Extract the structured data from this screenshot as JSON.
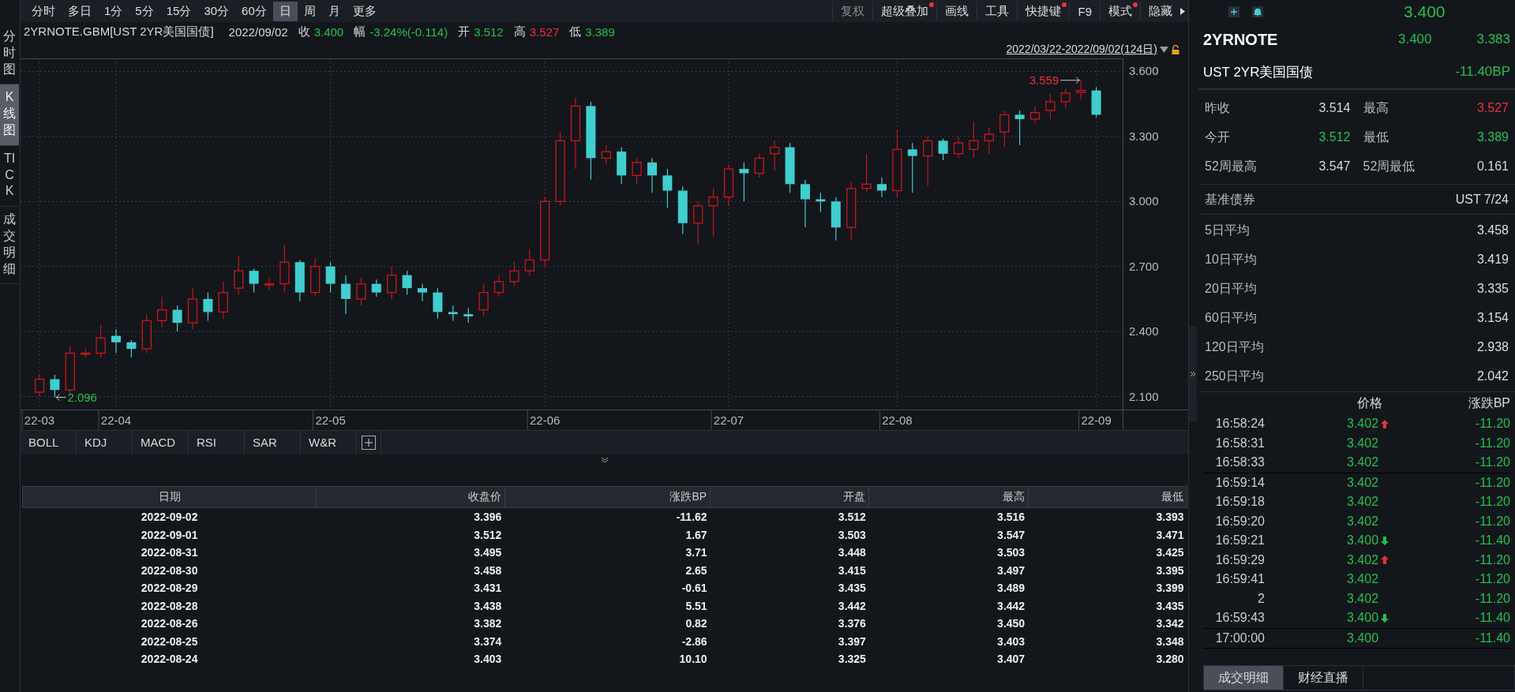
{
  "side_tabs": [
    {
      "label": "分时图",
      "selected": false
    },
    {
      "label": "K线图",
      "selected": true
    },
    {
      "label": "TICK",
      "selected": false
    },
    {
      "label": "成交明细",
      "selected": false
    }
  ],
  "toolbar": {
    "periods": [
      {
        "label": "分时",
        "selected": false
      },
      {
        "label": "多日",
        "selected": false
      },
      {
        "label": "1分",
        "selected": false
      },
      {
        "label": "5分",
        "selected": false
      },
      {
        "label": "15分",
        "selected": false
      },
      {
        "label": "30分",
        "selected": false
      },
      {
        "label": "60分",
        "selected": false
      },
      {
        "label": "日",
        "selected": true
      },
      {
        "label": "周",
        "selected": false
      },
      {
        "label": "月",
        "selected": false
      },
      {
        "label": "更多",
        "selected": false
      }
    ],
    "tools": [
      {
        "label": "复权",
        "disabled": true,
        "dot": false
      },
      {
        "label": "超级叠加",
        "disabled": false,
        "dot": true
      },
      {
        "label": "画线",
        "disabled": false,
        "dot": false
      },
      {
        "label": "工具",
        "disabled": false,
        "dot": false
      },
      {
        "label": "快捷键",
        "disabled": false,
        "dot": true
      },
      {
        "label": "F9",
        "disabled": false,
        "dot": false
      },
      {
        "label": "模式",
        "disabled": false,
        "dot": true
      },
      {
        "label": "隐藏",
        "disabled": false,
        "dot": false
      }
    ]
  },
  "info": {
    "symbol": "2YRNOTE.GBM[UST 2YR美国国债]",
    "date": "2022/09/02",
    "fields": [
      {
        "label": "收",
        "value": "3.400",
        "color": "#1fc14f"
      },
      {
        "label": "幅",
        "value": "-3.24%(-0.114)",
        "color": "#1fc14f"
      },
      {
        "label": "开",
        "value": "3.512",
        "color": "#1fc14f"
      },
      {
        "label": "高",
        "value": "3.527",
        "color": "#e8323c"
      },
      {
        "label": "低",
        "value": "3.389",
        "color": "#1fc14f"
      }
    ]
  },
  "range": {
    "label": "2022/03/22-2022/09/02(124日)",
    "locked": false
  },
  "chart": {
    "chart_data": {
      "type": "candlestick",
      "ylim": [
        2.04,
        3.66
      ],
      "grid": true,
      "yticks": [
        {
          "value": 3.6,
          "label": "3.600"
        },
        {
          "value": 3.3,
          "label": "3.300"
        },
        {
          "value": 3.0,
          "label": "3.000"
        },
        {
          "value": 2.7,
          "label": "2.700"
        },
        {
          "value": 2.4,
          "label": "2.400"
        },
        {
          "value": 2.1,
          "label": "2.100"
        }
      ],
      "categories": [
        "22-03",
        null,
        null,
        null,
        null,
        "22-04",
        null,
        null,
        null,
        null,
        null,
        null,
        null,
        null,
        null,
        null,
        null,
        null,
        null,
        "22-05",
        null,
        null,
        null,
        null,
        null,
        null,
        null,
        null,
        null,
        null,
        null,
        null,
        null,
        "22-06",
        null,
        null,
        null,
        null,
        null,
        null,
        null,
        null,
        null,
        null,
        null,
        "22-07",
        null,
        null,
        null,
        null,
        null,
        null,
        null,
        null,
        null,
        null,
        "22-08",
        null,
        null,
        null,
        null,
        null,
        null,
        null,
        null,
        null,
        null,
        null,
        null,
        "22-09"
      ],
      "ohlc": [
        [
          2.12,
          2.2,
          2.1,
          2.18
        ],
        [
          2.18,
          2.2,
          2.096,
          2.13
        ],
        [
          2.13,
          2.33,
          2.11,
          2.3
        ],
        [
          2.3,
          2.32,
          2.28,
          2.3
        ],
        [
          2.3,
          2.43,
          2.28,
          2.37
        ],
        [
          2.38,
          2.41,
          2.3,
          2.35
        ],
        [
          2.35,
          2.36,
          2.28,
          2.32
        ],
        [
          2.32,
          2.48,
          2.3,
          2.45
        ],
        [
          2.45,
          2.56,
          2.42,
          2.5
        ],
        [
          2.5,
          2.52,
          2.4,
          2.44
        ],
        [
          2.44,
          2.6,
          2.41,
          2.55
        ],
        [
          2.55,
          2.58,
          2.45,
          2.49
        ],
        [
          2.49,
          2.63,
          2.46,
          2.58
        ],
        [
          2.6,
          2.75,
          2.57,
          2.68
        ],
        [
          2.68,
          2.69,
          2.58,
          2.62
        ],
        [
          2.62,
          2.65,
          2.59,
          2.62
        ],
        [
          2.62,
          2.8,
          2.58,
          2.72
        ],
        [
          2.72,
          2.73,
          2.54,
          2.58
        ],
        [
          2.58,
          2.74,
          2.56,
          2.7
        ],
        [
          2.7,
          2.72,
          2.58,
          2.62
        ],
        [
          2.62,
          2.66,
          2.48,
          2.55
        ],
        [
          2.55,
          2.65,
          2.52,
          2.62
        ],
        [
          2.62,
          2.64,
          2.56,
          2.58
        ],
        [
          2.58,
          2.7,
          2.55,
          2.66
        ],
        [
          2.66,
          2.68,
          2.57,
          2.6
        ],
        [
          2.6,
          2.62,
          2.54,
          2.58
        ],
        [
          2.58,
          2.6,
          2.46,
          2.49
        ],
        [
          2.49,
          2.52,
          2.45,
          2.48
        ],
        [
          2.48,
          2.51,
          2.44,
          2.47
        ],
        [
          2.5,
          2.62,
          2.47,
          2.58
        ],
        [
          2.58,
          2.66,
          2.56,
          2.63
        ],
        [
          2.63,
          2.72,
          2.61,
          2.68
        ],
        [
          2.68,
          2.78,
          2.66,
          2.73
        ],
        [
          2.73,
          3.02,
          2.7,
          3.0
        ],
        [
          3.0,
          3.32,
          2.98,
          3.28
        ],
        [
          3.28,
          3.48,
          3.15,
          3.44
        ],
        [
          3.44,
          3.46,
          3.1,
          3.2
        ],
        [
          3.2,
          3.26,
          3.17,
          3.23
        ],
        [
          3.23,
          3.25,
          3.08,
          3.12
        ],
        [
          3.12,
          3.2,
          3.08,
          3.18
        ],
        [
          3.18,
          3.2,
          3.04,
          3.12
        ],
        [
          3.12,
          3.15,
          2.97,
          3.05
        ],
        [
          3.05,
          3.07,
          2.85,
          2.9
        ],
        [
          2.9,
          3.0,
          2.8,
          2.98
        ],
        [
          2.98,
          3.06,
          2.84,
          3.02
        ],
        [
          3.02,
          3.17,
          2.98,
          3.15
        ],
        [
          3.15,
          3.18,
          3.0,
          3.13
        ],
        [
          3.13,
          3.22,
          3.11,
          3.2
        ],
        [
          3.22,
          3.28,
          3.14,
          3.25
        ],
        [
          3.25,
          3.27,
          3.04,
          3.08
        ],
        [
          3.08,
          3.1,
          2.88,
          3.01
        ],
        [
          3.01,
          3.04,
          2.95,
          3.0
        ],
        [
          3.0,
          3.02,
          2.82,
          2.88
        ],
        [
          2.88,
          3.09,
          2.82,
          3.06
        ],
        [
          3.06,
          3.22,
          3.04,
          3.08
        ],
        [
          3.08,
          3.11,
          3.02,
          3.05
        ],
        [
          3.05,
          3.33,
          3.02,
          3.24
        ],
        [
          3.24,
          3.27,
          3.04,
          3.21
        ],
        [
          3.21,
          3.3,
          3.07,
          3.28
        ],
        [
          3.28,
          3.29,
          3.19,
          3.22
        ],
        [
          3.22,
          3.3,
          3.2,
          3.27
        ],
        [
          3.24,
          3.37,
          3.2,
          3.28
        ],
        [
          3.28,
          3.34,
          3.22,
          3.31
        ],
        [
          3.32,
          3.42,
          3.25,
          3.4
        ],
        [
          3.4,
          3.42,
          3.26,
          3.38
        ],
        [
          3.38,
          3.44,
          3.36,
          3.41
        ],
        [
          3.42,
          3.5,
          3.38,
          3.46
        ],
        [
          3.46,
          3.52,
          3.43,
          3.5
        ],
        [
          3.503,
          3.559,
          3.471,
          3.512
        ],
        [
          3.512,
          3.527,
          3.389,
          3.4
        ]
      ],
      "annotations": [
        "3.559",
        "2.096"
      ]
    }
  },
  "indicators": [
    "BOLL",
    "KDJ",
    "MACD",
    "RSI",
    "SAR",
    "W&R"
  ],
  "table": {
    "columns": [
      "日期",
      "收盘价",
      "涨跌BP",
      "开盘",
      "最高",
      "最低"
    ],
    "rows": [
      [
        "2022-09-02",
        "3.396",
        "-11.62",
        "3.512",
        "3.516",
        "3.393"
      ],
      [
        "2022-09-01",
        "3.512",
        "1.67",
        "3.503",
        "3.547",
        "3.471"
      ],
      [
        "2022-08-31",
        "3.495",
        "3.71",
        "3.448",
        "3.503",
        "3.425"
      ],
      [
        "2022-08-30",
        "3.458",
        "2.65",
        "3.415",
        "3.497",
        "3.395"
      ],
      [
        "2022-08-29",
        "3.431",
        "-0.61",
        "3.435",
        "3.489",
        "3.399"
      ],
      [
        "2022-08-28",
        "3.438",
        "5.51",
        "3.442",
        "3.442",
        "3.435"
      ],
      [
        "2022-08-26",
        "3.382",
        "0.82",
        "3.376",
        "3.450",
        "3.342"
      ],
      [
        "2022-08-25",
        "3.374",
        "-2.86",
        "3.397",
        "3.403",
        "3.348"
      ],
      [
        "2022-08-24",
        "3.403",
        "10.10",
        "3.325",
        "3.407",
        "3.280"
      ]
    ]
  },
  "quote": {
    "last": "3.400",
    "code": "2YRNOTE",
    "bid": "3.400",
    "ask": "3.383",
    "name": "UST 2YR美国国债",
    "change": "-11.40BP",
    "stats": [
      {
        "label": "昨收",
        "value": "3.514",
        "color": "#d8d8d8"
      },
      {
        "label": "最高",
        "value": "3.527",
        "color": "#e8323c"
      },
      {
        "label": "今开",
        "value": "3.512",
        "color": "#1fc14f"
      },
      {
        "label": "最低",
        "value": "3.389",
        "color": "#1fc14f"
      },
      {
        "label": "52周最高",
        "value": "3.547",
        "color": "#d8d8d8"
      },
      {
        "label": "52周最低",
        "value": "0.161",
        "color": "#d8d8d8"
      }
    ],
    "benchmark": {
      "label": "基准债券",
      "value": "UST 7/24"
    },
    "averages": [
      {
        "label": "5日平均",
        "value": "3.458"
      },
      {
        "label": "10日平均",
        "value": "3.419"
      },
      {
        "label": "20日平均",
        "value": "3.335"
      },
      {
        "label": "60日平均",
        "value": "3.154"
      },
      {
        "label": "120日平均",
        "value": "2.938"
      },
      {
        "label": "250日平均",
        "value": "2.042"
      }
    ]
  },
  "ticks": {
    "columns": [
      "价格",
      "涨跌BP"
    ],
    "groups": [
      [
        {
          "time": "16:58:24",
          "price": "3.402",
          "up_arrow": true,
          "down_arrow": false,
          "change": "-11.20"
        },
        {
          "time": "16:58:31",
          "price": "3.402",
          "up_arrow": false,
          "down_arrow": false,
          "change": "-11.20"
        },
        {
          "time": "16:58:33",
          "price": "3.402",
          "up_arrow": false,
          "down_arrow": false,
          "change": "-11.20"
        }
      ],
      [
        {
          "time": "16:59:14",
          "price": "3.402",
          "up_arrow": false,
          "down_arrow": false,
          "change": "-11.20"
        },
        {
          "time": "16:59:18",
          "price": "3.402",
          "up_arrow": false,
          "down_arrow": false,
          "change": "-11.20"
        },
        {
          "time": "16:59:20",
          "price": "3.402",
          "up_arrow": false,
          "down_arrow": false,
          "change": "-11.20"
        },
        {
          "time": "16:59:21",
          "price": "3.400",
          "up_arrow": false,
          "down_arrow": true,
          "change": "-11.40"
        },
        {
          "time": "16:59:29",
          "price": "3.402",
          "up_arrow": true,
          "down_arrow": false,
          "change": "-11.20"
        },
        {
          "time": "16:59:41",
          "price": "3.402",
          "up_arrow": false,
          "down_arrow": false,
          "change": "-11.20"
        },
        {
          "time": "2",
          "price": "3.402",
          "up_arrow": false,
          "down_arrow": false,
          "change": "-11.20"
        },
        {
          "time": "16:59:43",
          "price": "3.400",
          "up_arrow": false,
          "down_arrow": true,
          "change": "-11.40"
        }
      ],
      [
        {
          "time": "17:00:00",
          "price": "3.400",
          "up_arrow": false,
          "down_arrow": false,
          "change": "-11.40"
        }
      ]
    ]
  },
  "bottom_tabs": [
    {
      "label": "成交明细",
      "selected": true
    },
    {
      "label": "财经直播",
      "selected": false
    }
  ]
}
